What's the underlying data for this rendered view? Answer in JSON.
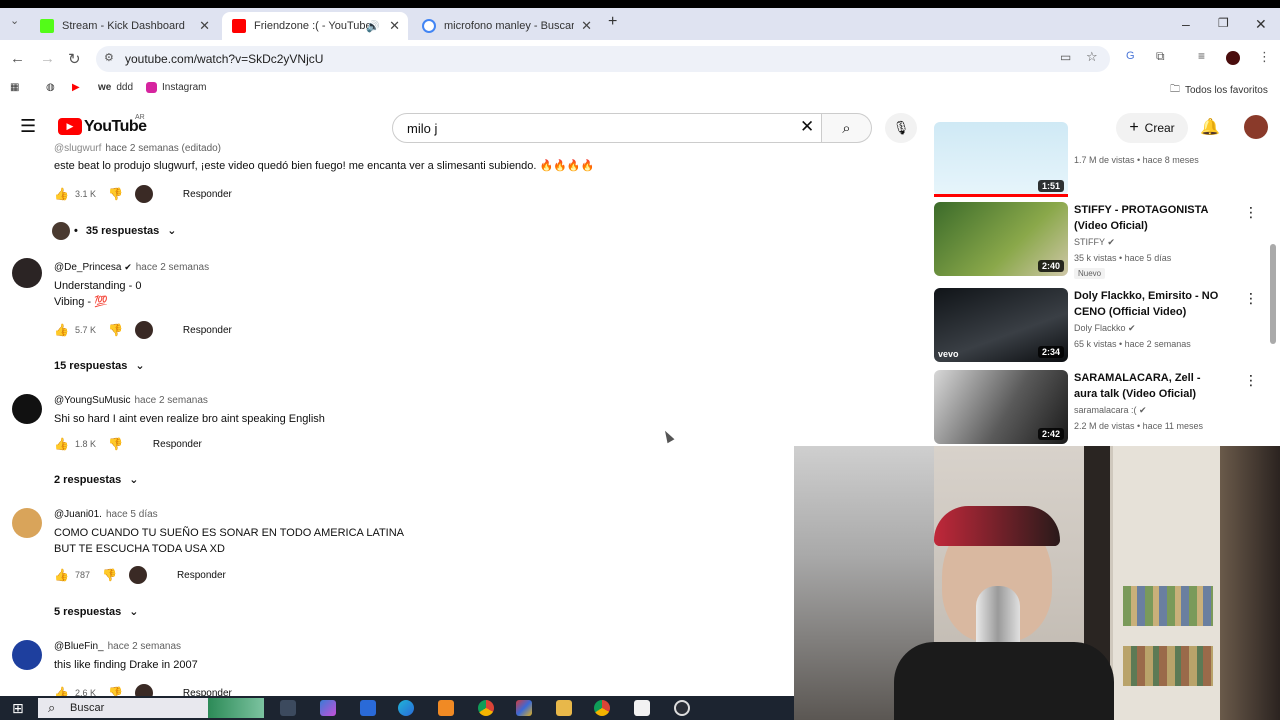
{
  "browser": {
    "tabs": [
      {
        "label": "Stream - Kick Dashboard",
        "color": "#53fc18"
      },
      {
        "label": "Friendzone :( - YouTube",
        "color": "#ff0000"
      },
      {
        "label": "microfono manley - Buscar con",
        "color": "#4285f4"
      }
    ],
    "url": "youtube.com/watch?v=SkDc2yVNjcU",
    "bookmarks": [
      "ddd",
      "Instagram"
    ],
    "all_bookmarks": "Todos los favoritos"
  },
  "youtube": {
    "logo": "YouTube",
    "region": "AR",
    "search_value": "milo j",
    "create_label": "Crear"
  },
  "comments": [
    {
      "author": "@slugwurf",
      "time": "hace 2 semanas (editado)",
      "text": "este beat lo produjo slugwurf, ¡este video quedó bien fuego! me encanta ver a slimesanti subiendo. 🔥🔥🔥🔥",
      "likes": "3.1 K",
      "reply": "Responder",
      "replies": "35 respuestas"
    },
    {
      "author": "@De_Princesa",
      "time": "hace 2 semanas",
      "text": "Understanding - 0",
      "text2": "Vibing - 💯",
      "likes": "5.7 K",
      "reply": "Responder",
      "replies": "15 respuestas"
    },
    {
      "author": "@YoungSuMusic",
      "time": "hace 2 semanas",
      "text": "Shi so hard I aint even realize bro aint speaking English",
      "likes": "1.8 K",
      "reply": "Responder",
      "replies": "2 respuestas"
    },
    {
      "author": "@Juani01.",
      "time": "hace 5 días",
      "text": "COMO CUANDO TU SUEÑO ES SONAR EN TODO AMERICA LATINA",
      "text2": "BUT TE ESCUCHA TODA USA XD",
      "likes": "787",
      "reply": "Responder",
      "replies": "5 respuestas"
    },
    {
      "author": "@BlueFin_",
      "time": "hace 2 semanas",
      "text": "this like finding Drake in 2007",
      "likes": "2.6 K",
      "reply": "Responder"
    }
  ],
  "sidebar_videos": [
    {
      "meta": "1.7 M de vistas • hace 8 meses",
      "duration": "1:51"
    },
    {
      "title": "STIFFY - PROTAGONISTA (Video Oficial)",
      "channel": "STIFFY",
      "meta": "35 k vistas • hace 5 días",
      "badge": "Nuevo",
      "duration": "2:40"
    },
    {
      "title": "Doly Flackko, Emirsito - NO CENO (Official Video)",
      "channel": "Doly Flackko",
      "meta": "65 k vistas • hace 2 semanas",
      "duration": "2:34",
      "watermark": "vevo"
    },
    {
      "title": "SARAMALACARA, Zell - aura talk (Video Oficial)",
      "channel": "saramalacara :(",
      "meta": "2.2 M de vistas • hace 11 meses",
      "duration": "2:42"
    }
  ],
  "taskbar": {
    "search_placeholder": "Buscar"
  }
}
